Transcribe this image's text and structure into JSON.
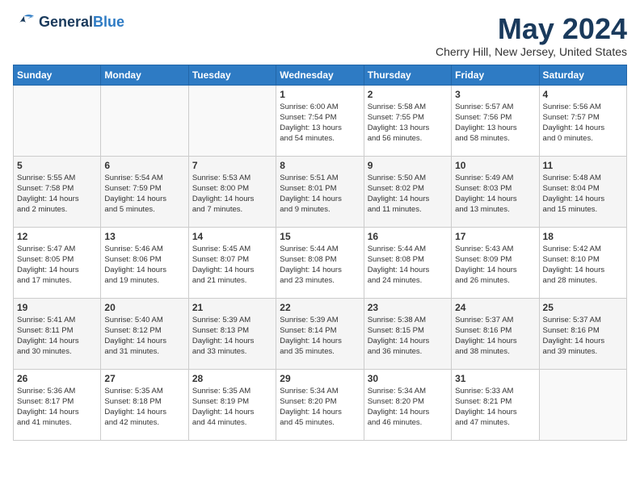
{
  "header": {
    "logo_line1": "General",
    "logo_line2": "Blue",
    "month_title": "May 2024",
    "location": "Cherry Hill, New Jersey, United States"
  },
  "weekdays": [
    "Sunday",
    "Monday",
    "Tuesday",
    "Wednesday",
    "Thursday",
    "Friday",
    "Saturday"
  ],
  "weeks": [
    [
      {
        "day": "",
        "info": ""
      },
      {
        "day": "",
        "info": ""
      },
      {
        "day": "",
        "info": ""
      },
      {
        "day": "1",
        "info": "Sunrise: 6:00 AM\nSunset: 7:54 PM\nDaylight: 13 hours\nand 54 minutes."
      },
      {
        "day": "2",
        "info": "Sunrise: 5:58 AM\nSunset: 7:55 PM\nDaylight: 13 hours\nand 56 minutes."
      },
      {
        "day": "3",
        "info": "Sunrise: 5:57 AM\nSunset: 7:56 PM\nDaylight: 13 hours\nand 58 minutes."
      },
      {
        "day": "4",
        "info": "Sunrise: 5:56 AM\nSunset: 7:57 PM\nDaylight: 14 hours\nand 0 minutes."
      }
    ],
    [
      {
        "day": "5",
        "info": "Sunrise: 5:55 AM\nSunset: 7:58 PM\nDaylight: 14 hours\nand 2 minutes."
      },
      {
        "day": "6",
        "info": "Sunrise: 5:54 AM\nSunset: 7:59 PM\nDaylight: 14 hours\nand 5 minutes."
      },
      {
        "day": "7",
        "info": "Sunrise: 5:53 AM\nSunset: 8:00 PM\nDaylight: 14 hours\nand 7 minutes."
      },
      {
        "day": "8",
        "info": "Sunrise: 5:51 AM\nSunset: 8:01 PM\nDaylight: 14 hours\nand 9 minutes."
      },
      {
        "day": "9",
        "info": "Sunrise: 5:50 AM\nSunset: 8:02 PM\nDaylight: 14 hours\nand 11 minutes."
      },
      {
        "day": "10",
        "info": "Sunrise: 5:49 AM\nSunset: 8:03 PM\nDaylight: 14 hours\nand 13 minutes."
      },
      {
        "day": "11",
        "info": "Sunrise: 5:48 AM\nSunset: 8:04 PM\nDaylight: 14 hours\nand 15 minutes."
      }
    ],
    [
      {
        "day": "12",
        "info": "Sunrise: 5:47 AM\nSunset: 8:05 PM\nDaylight: 14 hours\nand 17 minutes."
      },
      {
        "day": "13",
        "info": "Sunrise: 5:46 AM\nSunset: 8:06 PM\nDaylight: 14 hours\nand 19 minutes."
      },
      {
        "day": "14",
        "info": "Sunrise: 5:45 AM\nSunset: 8:07 PM\nDaylight: 14 hours\nand 21 minutes."
      },
      {
        "day": "15",
        "info": "Sunrise: 5:44 AM\nSunset: 8:08 PM\nDaylight: 14 hours\nand 23 minutes."
      },
      {
        "day": "16",
        "info": "Sunrise: 5:44 AM\nSunset: 8:08 PM\nDaylight: 14 hours\nand 24 minutes."
      },
      {
        "day": "17",
        "info": "Sunrise: 5:43 AM\nSunset: 8:09 PM\nDaylight: 14 hours\nand 26 minutes."
      },
      {
        "day": "18",
        "info": "Sunrise: 5:42 AM\nSunset: 8:10 PM\nDaylight: 14 hours\nand 28 minutes."
      }
    ],
    [
      {
        "day": "19",
        "info": "Sunrise: 5:41 AM\nSunset: 8:11 PM\nDaylight: 14 hours\nand 30 minutes."
      },
      {
        "day": "20",
        "info": "Sunrise: 5:40 AM\nSunset: 8:12 PM\nDaylight: 14 hours\nand 31 minutes."
      },
      {
        "day": "21",
        "info": "Sunrise: 5:39 AM\nSunset: 8:13 PM\nDaylight: 14 hours\nand 33 minutes."
      },
      {
        "day": "22",
        "info": "Sunrise: 5:39 AM\nSunset: 8:14 PM\nDaylight: 14 hours\nand 35 minutes."
      },
      {
        "day": "23",
        "info": "Sunrise: 5:38 AM\nSunset: 8:15 PM\nDaylight: 14 hours\nand 36 minutes."
      },
      {
        "day": "24",
        "info": "Sunrise: 5:37 AM\nSunset: 8:16 PM\nDaylight: 14 hours\nand 38 minutes."
      },
      {
        "day": "25",
        "info": "Sunrise: 5:37 AM\nSunset: 8:16 PM\nDaylight: 14 hours\nand 39 minutes."
      }
    ],
    [
      {
        "day": "26",
        "info": "Sunrise: 5:36 AM\nSunset: 8:17 PM\nDaylight: 14 hours\nand 41 minutes."
      },
      {
        "day": "27",
        "info": "Sunrise: 5:35 AM\nSunset: 8:18 PM\nDaylight: 14 hours\nand 42 minutes."
      },
      {
        "day": "28",
        "info": "Sunrise: 5:35 AM\nSunset: 8:19 PM\nDaylight: 14 hours\nand 44 minutes."
      },
      {
        "day": "29",
        "info": "Sunrise: 5:34 AM\nSunset: 8:20 PM\nDaylight: 14 hours\nand 45 minutes."
      },
      {
        "day": "30",
        "info": "Sunrise: 5:34 AM\nSunset: 8:20 PM\nDaylight: 14 hours\nand 46 minutes."
      },
      {
        "day": "31",
        "info": "Sunrise: 5:33 AM\nSunset: 8:21 PM\nDaylight: 14 hours\nand 47 minutes."
      },
      {
        "day": "",
        "info": ""
      }
    ]
  ]
}
